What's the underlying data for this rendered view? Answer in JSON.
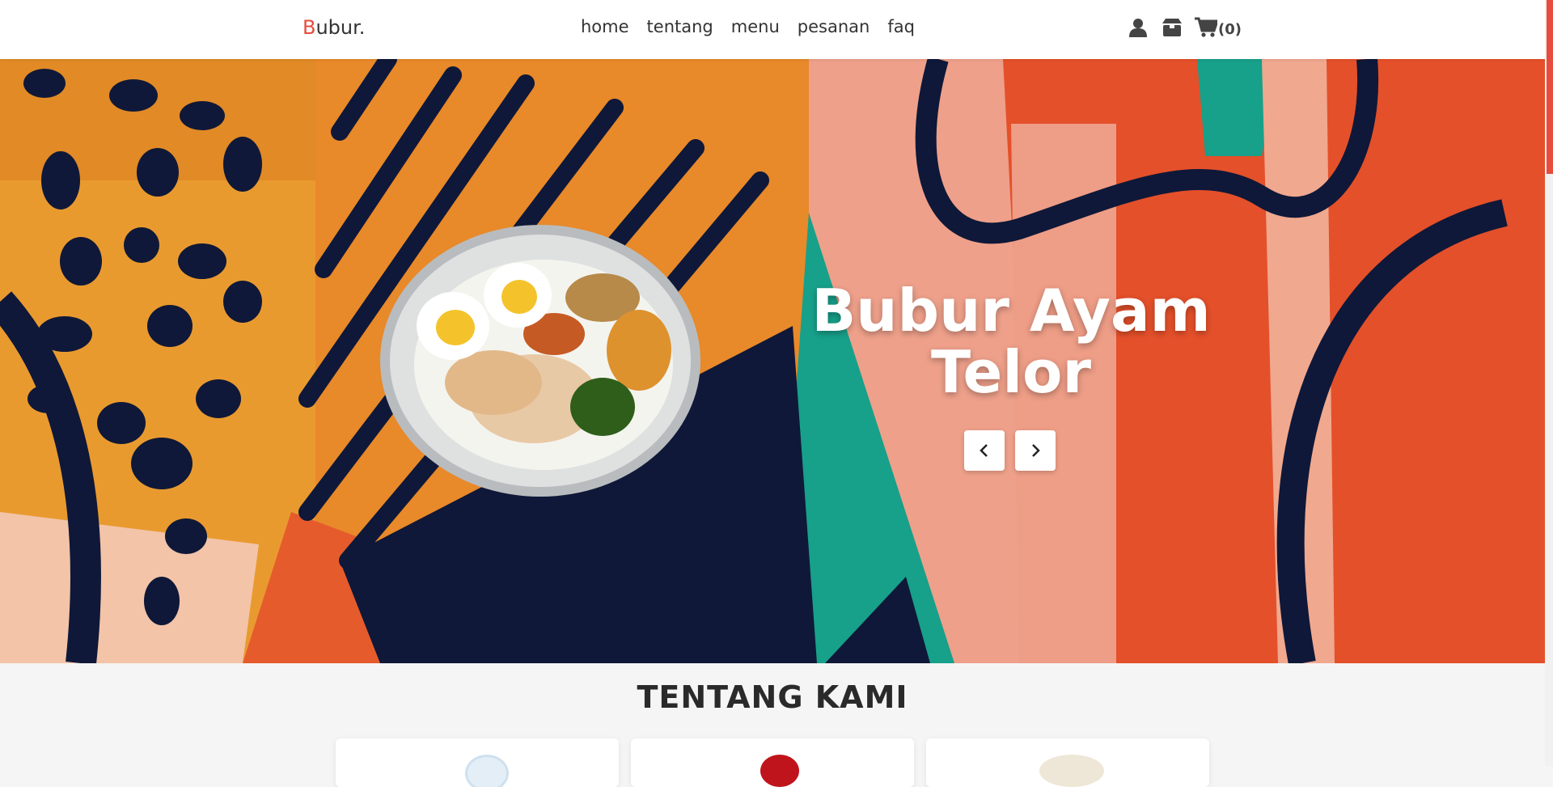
{
  "navbar": {
    "logo_first_letter": "B",
    "logo_rest": "ubur.",
    "links": [
      "home",
      "tentang",
      "menu",
      "pesanan",
      "faq"
    ],
    "icons": [
      "user-icon",
      "box-icon",
      "cart-icon"
    ],
    "cart_count": "(0)"
  },
  "hero": {
    "title_line1": "Bubur Ayam",
    "title_line2": "Telor",
    "prev_icon": "chevron-left-icon",
    "next_icon": "chevron-right-icon"
  },
  "about": {
    "title": "TENTANG KAMI"
  },
  "colors": {
    "accent": "#e74c3c",
    "hero_orange": "#e9892a",
    "hero_navy": "#0f1838",
    "hero_teal": "#17a08a",
    "hero_pink": "#eea08a",
    "hero_red": "#e4502a"
  }
}
